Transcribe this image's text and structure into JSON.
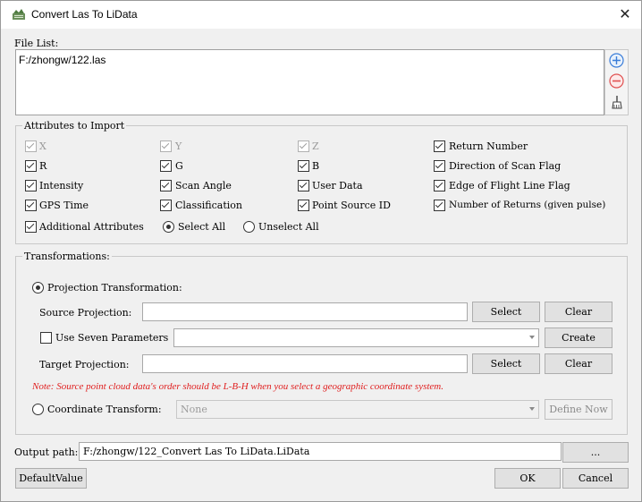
{
  "window": {
    "title": "Convert Las To LiData",
    "close_glyph": "✕"
  },
  "file_list": {
    "label": "File List:",
    "items": [
      "F:/zhongw/122.las"
    ],
    "buttons": [
      {
        "name": "add-icon",
        "glyph": "+"
      },
      {
        "name": "remove-icon",
        "glyph": "−"
      },
      {
        "name": "broom-icon",
        "glyph": ""
      }
    ]
  },
  "attributes": {
    "title": "Attributes to Import",
    "checkboxes": [
      {
        "label": "X",
        "checked": true,
        "enabled": false
      },
      {
        "label": "Y",
        "checked": true,
        "enabled": false
      },
      {
        "label": "Z",
        "checked": true,
        "enabled": false
      },
      {
        "label": "Return Number",
        "checked": true,
        "enabled": true
      },
      {
        "label": "R",
        "checked": true,
        "enabled": true
      },
      {
        "label": "G",
        "checked": true,
        "enabled": true
      },
      {
        "label": "B",
        "checked": true,
        "enabled": true
      },
      {
        "label": "Direction of Scan Flag",
        "checked": true,
        "enabled": true
      },
      {
        "label": "Intensity",
        "checked": true,
        "enabled": true
      },
      {
        "label": "Scan Angle",
        "checked": true,
        "enabled": true
      },
      {
        "label": "User Data",
        "checked": true,
        "enabled": true
      },
      {
        "label": "Edge of Flight Line Flag",
        "checked": true,
        "enabled": true
      },
      {
        "label": "GPS Time",
        "checked": true,
        "enabled": true
      },
      {
        "label": "Classification",
        "checked": true,
        "enabled": true
      },
      {
        "label": "Point Source ID",
        "checked": true,
        "enabled": true
      },
      {
        "label": "Number of Returns (given pulse)",
        "checked": true,
        "enabled": true
      }
    ],
    "additional": {
      "label": "Additional Attributes",
      "checked": true
    },
    "select_all": {
      "label": "Select All",
      "selected": true
    },
    "unselect_all": {
      "label": "Unselect All",
      "selected": false
    }
  },
  "transformations": {
    "title": "Transformations:",
    "projection": {
      "label": "Projection Transformation:",
      "selected": true
    },
    "source_projection": {
      "label": "Source Projection:",
      "value": "",
      "select_label": "Select",
      "clear_label": "Clear"
    },
    "seven_params": {
      "label": "Use Seven Parameters",
      "checked": false,
      "value": "",
      "create_label": "Create"
    },
    "target_projection": {
      "label": "Target Projection:",
      "value": "",
      "select_label": "Select",
      "clear_label": "Clear"
    },
    "note": "Note: Source point cloud data's order should be L-B-H when you select a geographic coordinate system.",
    "coordinate": {
      "label": "Coordinate Transform:",
      "selected": false,
      "value": "None",
      "define_label": "Define Now"
    }
  },
  "output": {
    "label": "Output path:",
    "value": "F:/zhongw/122_Convert Las To LiData.LiData",
    "browse_label": "..."
  },
  "footer": {
    "default_label": "DefaultValue",
    "ok_label": "OK",
    "cancel_label": "Cancel"
  },
  "colors": {
    "note": "#e01e1e",
    "add_icon": "#3b7dd8",
    "remove_icon": "#e05050"
  }
}
